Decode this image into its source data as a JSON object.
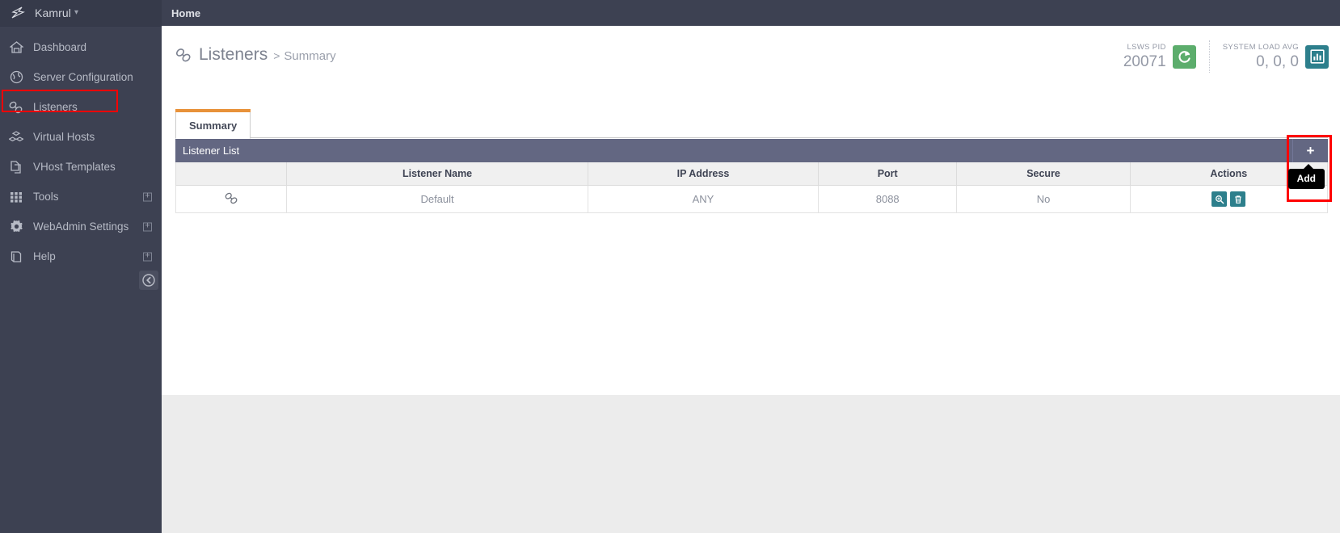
{
  "brand": {
    "name": "Kamrul",
    "logo_icon": "lightning-logo-icon",
    "caret_icon": "chevron-down-icon"
  },
  "topbar": {
    "home_label": "Home"
  },
  "sidebar": {
    "items": [
      {
        "label": "Dashboard",
        "icon": "home-icon",
        "expandable": false,
        "active": false
      },
      {
        "label": "Server Configuration",
        "icon": "globe-icon",
        "expandable": false,
        "active": false
      },
      {
        "label": "Listeners",
        "icon": "link-chain-icon",
        "expandable": false,
        "active": true
      },
      {
        "label": "Virtual Hosts",
        "icon": "cubes-icon",
        "expandable": false,
        "active": false
      },
      {
        "label": "VHost Templates",
        "icon": "copy-files-icon",
        "expandable": false,
        "active": false
      },
      {
        "label": "Tools",
        "icon": "grid-dots-icon",
        "expandable": true,
        "active": false
      },
      {
        "label": "WebAdmin Settings",
        "icon": "gear-icon",
        "expandable": true,
        "active": false
      },
      {
        "label": "Help",
        "icon": "book-icon",
        "expandable": true,
        "active": false
      }
    ],
    "collapse_icon": "arrow-left-circle-icon",
    "expander_icon": "plus-square-icon",
    "highlight_color": "#ff0000"
  },
  "page": {
    "title_icon": "link-chain-icon",
    "title": "Listeners",
    "separator": ">",
    "subtitle": "Summary"
  },
  "stats": {
    "pid": {
      "label": "LSWS PID",
      "value": "20071",
      "button_icon": "restart-icon",
      "button_color": "#5cad6c"
    },
    "load": {
      "label": "SYSTEM LOAD AVG",
      "value": "0, 0, 0",
      "button_icon": "bar-chart-icon",
      "button_color": "#2d7f8c"
    }
  },
  "tabs": [
    {
      "label": "Summary",
      "active": true
    }
  ],
  "panel": {
    "title": "Listener List",
    "add_icon": "plus-icon",
    "tooltip": "Add",
    "highlight_color": "#ff0000",
    "columns": [
      "",
      "Listener Name",
      "IP Address",
      "Port",
      "Secure",
      "Actions"
    ],
    "rows": [
      {
        "icon": "link-chain-icon",
        "name": "Default",
        "ip": "ANY",
        "port": "8088",
        "secure": "No",
        "actions": [
          "view-icon",
          "delete-icon"
        ]
      }
    ]
  }
}
